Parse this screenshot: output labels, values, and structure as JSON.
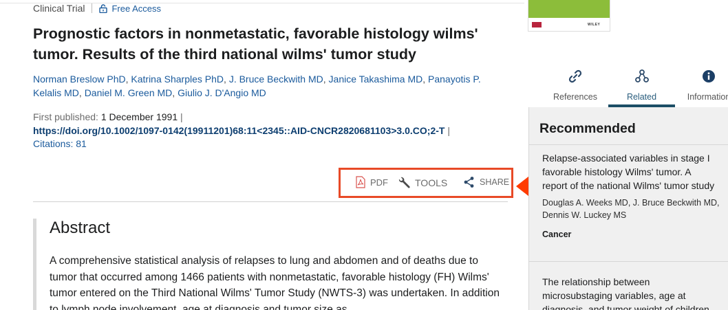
{
  "article": {
    "type": "Clinical Trial",
    "access": "Free Access",
    "title": "Prognostic factors in nonmetastatic, favorable histology wilms' tumor. Results of the third national wilms' tumor study",
    "authors": [
      "Norman Breslow PhD",
      "Katrina Sharples PhD",
      "J. Bruce Beckwith MD",
      "Janice Takashima MD",
      "Panayotis P. Kelalis MD",
      "Daniel M. Green MD",
      "Giulio J. D'Angio MD"
    ],
    "first_published_label": "First published:",
    "first_published": "1 December 1991",
    "doi": "https://doi.org/10.1002/1097-0142(19911201)68:11<2345::AID-CNCR2820681103>3.0.CO;2-T",
    "citations": "Citations: 81"
  },
  "toolbar": {
    "pdf_label": "PDF",
    "tools_label": "TOOLS",
    "share_label": "SHARE",
    "highlight_color": "#e84a27"
  },
  "abstract": {
    "heading": "Abstract",
    "text": "A comprehensive statistical analysis of relapses to lung and abdomen and of deaths due to tumor that occurred among 1466 patients with nonmetastatic, favorable histology (FH) Wilms' tumor entered on the Third National Wilms' Tumor Study (NWTS-3) was undertaken. In addition to lymph node involvement, age at diagnosis and tumor size as"
  },
  "sidebar": {
    "cover_label": "WILEY",
    "tabs": [
      {
        "label": "References",
        "icon": "link-icon"
      },
      {
        "label": "Related",
        "icon": "related-network-icon"
      },
      {
        "label": "Information",
        "icon": "info-icon"
      }
    ],
    "active_tab": "Related",
    "recommended_title": "Recommended",
    "items": [
      {
        "title_lines": [
          "Relapse-associated variables in stage I",
          "favorable histology Wilms' tumor. A",
          "report of the national Wilms' tumor study"
        ],
        "authors_lines": [
          "Douglas A. Weeks MD, J. Bruce Beckwith MD,",
          "Dennis W. Luckey MS"
        ],
        "journal": "Cancer"
      },
      {
        "title_lines": [
          "The relationship between",
          "microsubstaging variables, age at",
          "diagnosis, and tumor weight of children"
        ]
      }
    ]
  },
  "colors": {
    "link": "#1a5a9c",
    "doi": "#0d3e70",
    "active_tab": "#1c4e66",
    "sidebar_bg": "#f0f0f0",
    "arrow": "#ff3c00"
  }
}
